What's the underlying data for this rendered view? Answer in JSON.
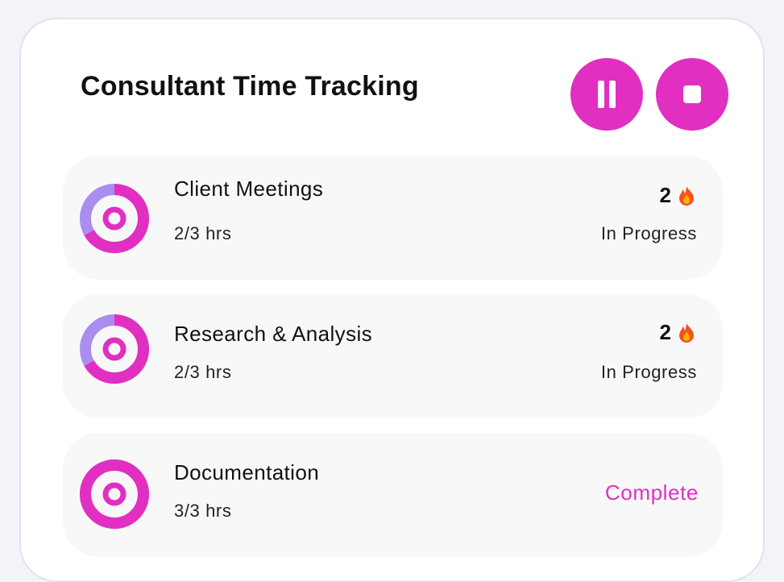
{
  "title": "Consultant Time Tracking",
  "controls": {
    "pause_icon": "pause-icon",
    "stop_icon": "stop-icon"
  },
  "colors": {
    "accent": "#e12fc2",
    "progress_remaining": "#a98ef0",
    "complete_text": "#e12fc2",
    "card_bg": "#f8f8f8"
  },
  "tasks": [
    {
      "name": "Client Meetings",
      "hours": "2/3 hrs",
      "progress": 0.667,
      "streak": "2",
      "streak_icon": "flame-icon",
      "status": "In Progress"
    },
    {
      "name": "Research & Analysis",
      "hours": "2/3 hrs",
      "progress": 0.667,
      "streak": "2",
      "streak_icon": "flame-icon",
      "status": "In Progress"
    },
    {
      "name": "Documentation",
      "hours": "3/3 hrs",
      "progress": 1.0,
      "status": "Complete"
    }
  ]
}
